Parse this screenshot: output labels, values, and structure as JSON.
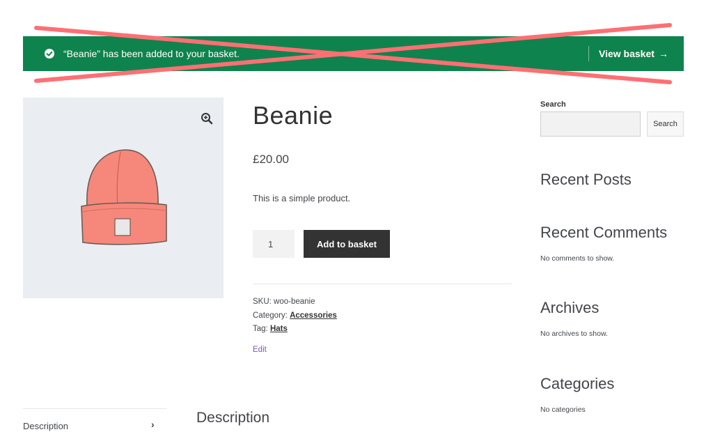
{
  "notice": {
    "message": "“Beanie” has been added to your basket.",
    "view_basket_label": "View basket",
    "arrow": "→",
    "accent_color": "#0f834d"
  },
  "product": {
    "title": "Beanie",
    "price": "£20.00",
    "short_description": "This is a simple product.",
    "quantity": "1",
    "add_button_label": "Add to basket",
    "sku_label": "SKU:",
    "sku_value": "woo-beanie",
    "category_label": "Category:",
    "category_value": "Accessories",
    "tag_label": "Tag:",
    "tag_value": "Hats",
    "edit_label": "Edit",
    "zoom_icon": "magnifier-plus-icon"
  },
  "sidebar": {
    "search_label": "Search",
    "search_button_label": "Search",
    "recent_posts_title": "Recent Posts",
    "recent_comments_title": "Recent Comments",
    "recent_comments_text": "No comments to show.",
    "archives_title": "Archives",
    "archives_text": "No archives to show.",
    "categories_title": "Categories",
    "categories_text": "No categories"
  },
  "tabs": {
    "items": [
      {
        "label": "Description"
      }
    ],
    "chevron": "›",
    "panel_title": "Description"
  }
}
